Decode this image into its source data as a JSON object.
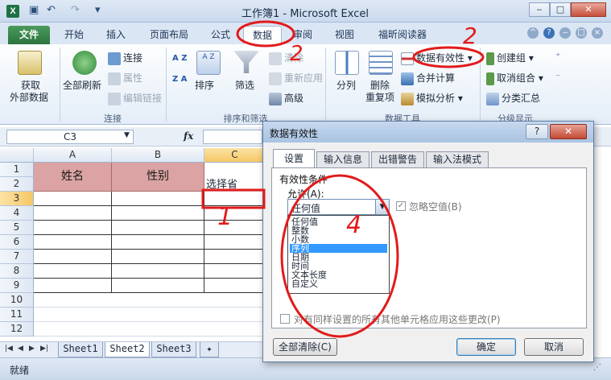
{
  "window": {
    "title": "工作簿1 - Microsoft Excel",
    "qat_undo": "↶",
    "qat_redo": "↷",
    "minimize": "‒",
    "maximize": "□",
    "close": "✕"
  },
  "tabs": [
    {
      "label": "文件"
    },
    {
      "label": "开始"
    },
    {
      "label": "插入"
    },
    {
      "label": "页面布局"
    },
    {
      "label": "公式"
    },
    {
      "label": "数据"
    },
    {
      "label": "审阅"
    },
    {
      "label": "视图"
    },
    {
      "label": "福昕阅读器"
    }
  ],
  "ribbon": {
    "get_external_line1": "获取",
    "get_external_line2": "外部数据",
    "refresh_all": "全部刷新",
    "connections": "连接",
    "properties": "属性",
    "edit_links": "编辑链接",
    "group_connections": "连接",
    "sort": "排序",
    "filter": "筛选",
    "clear": "清除",
    "reapply": "重新应用",
    "advanced": "高级",
    "group_sort_filter": "排序和筛选",
    "text_to_columns": "分列",
    "remove_dup_line1": "删除",
    "remove_dup_line2": "重复项",
    "data_validation": "数据有效性",
    "consolidate": "合并计算",
    "what_if": "模拟分析",
    "group_data_tools": "数据工具",
    "group": "创建组",
    "ungroup": "取消组合",
    "subtotal": "分类汇总",
    "group_outline": "分级显示",
    "sort_az": "A Z",
    "sort_za": "Z A"
  },
  "formula_bar": {
    "name_box": "C3",
    "fx": "fx"
  },
  "sheet": {
    "columns": [
      "A",
      "B",
      "C"
    ],
    "rows": [
      "1",
      "2",
      "3",
      "4",
      "5",
      "6",
      "7",
      "8",
      "9",
      "10",
      "11",
      "12"
    ],
    "header_a": "姓名",
    "header_b": "性别",
    "header_c": "选择省"
  },
  "sheet_tabs": {
    "nav": [
      "|◀",
      "◀",
      "▶",
      "▶|"
    ],
    "tabs": [
      "Sheet1",
      "Sheet2",
      "Sheet3"
    ]
  },
  "status": {
    "text": "就绪"
  },
  "dialog": {
    "title": "数据有效性",
    "help": "?",
    "close": "✕",
    "tabs": [
      "设置",
      "输入信息",
      "出错警告",
      "输入法模式"
    ],
    "criteria_label": "有效性条件",
    "allow_label": "允许(A):",
    "allow_value": "任何值",
    "ignore_blank": "忽略空值(B)",
    "options": [
      "任何值",
      "整数",
      "小数",
      "序列",
      "日期",
      "时间",
      "文本长度",
      "自定义"
    ],
    "selected_option": "序列",
    "apply_all": "对有同样设置的所有其他单元格应用这些更改(P)",
    "clear_all": "全部清除(C)",
    "ok": "确定",
    "cancel": "取消"
  },
  "annotations": {
    "n1": "1",
    "n2a": "2",
    "n2b": "2",
    "n4": "4",
    "color": "#e21b1b"
  }
}
